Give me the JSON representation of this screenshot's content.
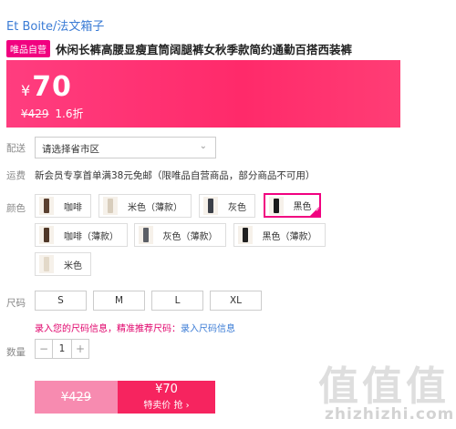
{
  "brand": "Et Boite/法文箱子",
  "tag": "唯品自营",
  "product_title": "休闲长裤高腰显瘦直筒阔腿裤女秋季款简约通勤百搭西装裤",
  "price": {
    "currency": "¥",
    "sale": "70",
    "original": "¥429",
    "discount": "1.6折"
  },
  "labels": {
    "delivery": "配送",
    "shipping": "运费",
    "color": "颜色",
    "size": "尺码",
    "quantity": "数量"
  },
  "delivery_select": {
    "value": "请选择省市区",
    "chevron": "chevron-down-icon"
  },
  "shipping_text": "新会员专享首单满38元免邮（限唯品自营商品，部分商品不可用）",
  "colors": [
    {
      "label": "咖啡",
      "swatch": "#5a4030"
    },
    {
      "label": "米色（薄款）",
      "swatch": "#d8cdbc"
    },
    {
      "label": "灰色",
      "swatch": "#3c4048"
    },
    {
      "label": "黑色",
      "swatch": "#1a1a1a",
      "selected": true
    },
    {
      "label": "咖啡（薄款）",
      "swatch": "#4f3728"
    },
    {
      "label": "灰色（薄款）",
      "swatch": "#5c5f66"
    },
    {
      "label": "黑色（薄款）",
      "swatch": "#202020"
    },
    {
      "label": "米色",
      "swatch": "#e3d9c9"
    }
  ],
  "sizes": [
    "S",
    "M",
    "L",
    "XL"
  ],
  "size_info": {
    "text": "录入您的尺码信息，精准推荐尺码：",
    "link": "录入尺码信息"
  },
  "quantity": {
    "minus": "−",
    "value": "1",
    "plus": "+"
  },
  "buy": {
    "original": "¥429",
    "price": "¥70",
    "label": "特卖价 抢 ›"
  },
  "watermark": {
    "main": "值值值",
    "sub": "zhizhizhi.com"
  }
}
